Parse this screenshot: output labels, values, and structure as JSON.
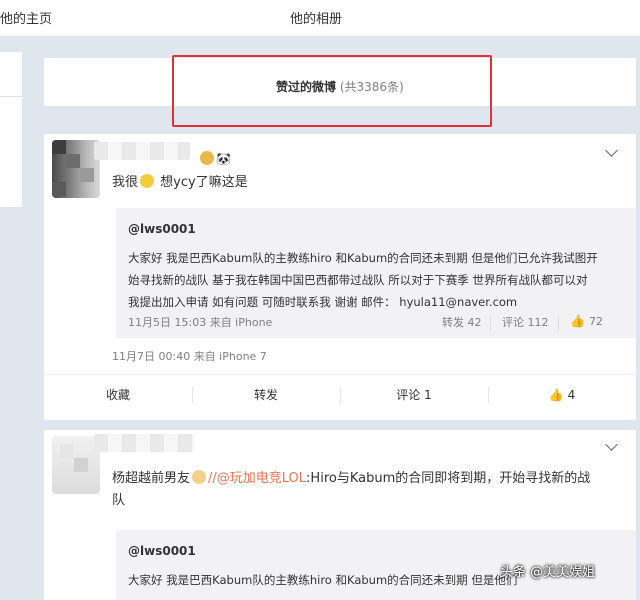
{
  "nav": {
    "home": "他的主页",
    "album": "他的相册"
  },
  "tab": {
    "title": "赞过的微博",
    "count": "(共3386条)"
  },
  "colors": {
    "highlight_box": "#e0303a",
    "link": "#eb7350"
  },
  "posts": [
    {
      "text_prefix": "我很",
      "text_suffix": "想ycy了嘛这是",
      "quote": {
        "author": "@lws0001",
        "lines": [
          "大家好 我是巴西Kabum队的主教练hiro 和Kabum的合同还未到期 但是他们已允许我试图开",
          "始寻找新的战队 基于我在韩国中国巴西都带过战队 所以对于下赛季 世界所有战队都可以对",
          "我提出加入申请 如有问题 可随时联系我 谢谢 邮件： hyula11@naver.com"
        ],
        "meta": "11月5日 15:03 来自 iPhone",
        "repost": "转发 42",
        "comment": "评论 112",
        "like": "72"
      },
      "time": "11月7日 00:40 来自 iPhone 7",
      "actions": {
        "fav": "收藏",
        "repost": "转发",
        "comment": "评论 1",
        "like": "4"
      }
    },
    {
      "text_prefix": "杨超越前男友",
      "text_slash": "//",
      "text_link": "@玩加电竞LOL",
      "text_rest_1": ":Hiro与Kabum的合同即将到期，开始寻找新的战",
      "text_rest_2": "队",
      "quote": {
        "author": "@lws0001",
        "line1": "大家好 我是巴西Kabum队的主教练hiro 和Kabum的合同还未到期 但是他们"
      }
    }
  ],
  "watermark": "头条 @美美娱姐"
}
